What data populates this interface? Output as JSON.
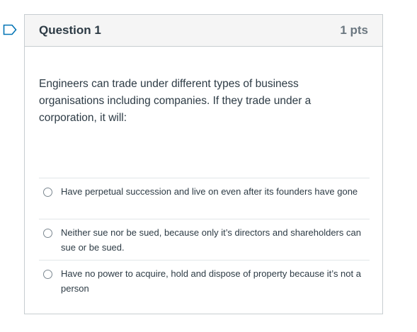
{
  "question": {
    "title": "Question 1",
    "points": "1 pts",
    "text": "Engineers can trade under different types of business organisations including companies. If they trade under a corporation, it will:",
    "answers": [
      {
        "label": "Have perpetual succession and live on even after its founders have gone",
        "selected": false
      },
      {
        "label": "Neither sue nor be sued, because only it’s directors and shareholders can sue or be sued.",
        "selected": false
      },
      {
        "label": "Have no power to acquire, hold and dispose of property because it’s not a person",
        "selected": false
      }
    ]
  },
  "icons": {
    "flag": "flag-outline-icon"
  },
  "colors": {
    "flag_accent": "#0374b5",
    "header_bg": "#f5f5f5",
    "text": "#2d3b45",
    "muted": "#6b7780"
  }
}
